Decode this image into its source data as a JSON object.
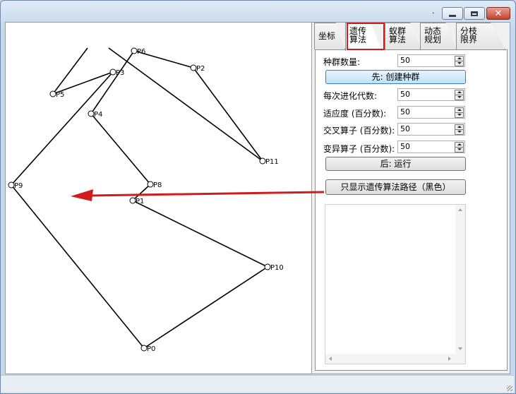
{
  "window": {
    "title": ".",
    "controls": {
      "minimize": "minimize",
      "maximize": "maximize",
      "close": "✕"
    }
  },
  "tabs": [
    {
      "label": "坐标"
    },
    {
      "label": "遗传\n算法",
      "active": true
    },
    {
      "label": "蚁群\n算法"
    },
    {
      "label": "动态\n规划"
    },
    {
      "label": "分枝\n限界"
    }
  ],
  "settings": {
    "population_label": "种群数量:",
    "population_value": "50",
    "create_button": "先: 创建种群",
    "generations_label": "每次进化代数:",
    "generations_value": "50",
    "fitness_label": "适应度 (百分数):",
    "fitness_value": "50",
    "crossover_label": "交叉算子 (百分数):",
    "crossover_value": "50",
    "mutation_label": "变异算子 (百分数):",
    "mutation_value": "50",
    "run_button": "后: 运行",
    "show_path_button": "只显示遗传算法路径（黑色）"
  },
  "graph": {
    "nodes": [
      {
        "id": "P0",
        "label": "P0"
      },
      {
        "id": "P1",
        "label": "P1"
      },
      {
        "id": "P2",
        "label": "P2"
      },
      {
        "id": "P3",
        "label": "P3"
      },
      {
        "id": "P4",
        "label": "P4"
      },
      {
        "id": "P5",
        "label": "P5"
      },
      {
        "id": "P6",
        "label": "P6"
      },
      {
        "id": "P8",
        "label": "P8"
      },
      {
        "id": "P9",
        "label": "P9"
      },
      {
        "id": "P10",
        "label": "P10"
      },
      {
        "id": "P11",
        "label": "P11"
      }
    ]
  },
  "annotations": {
    "highlight_color": "#d01c1c",
    "arrow_color": "#d01c1c"
  }
}
